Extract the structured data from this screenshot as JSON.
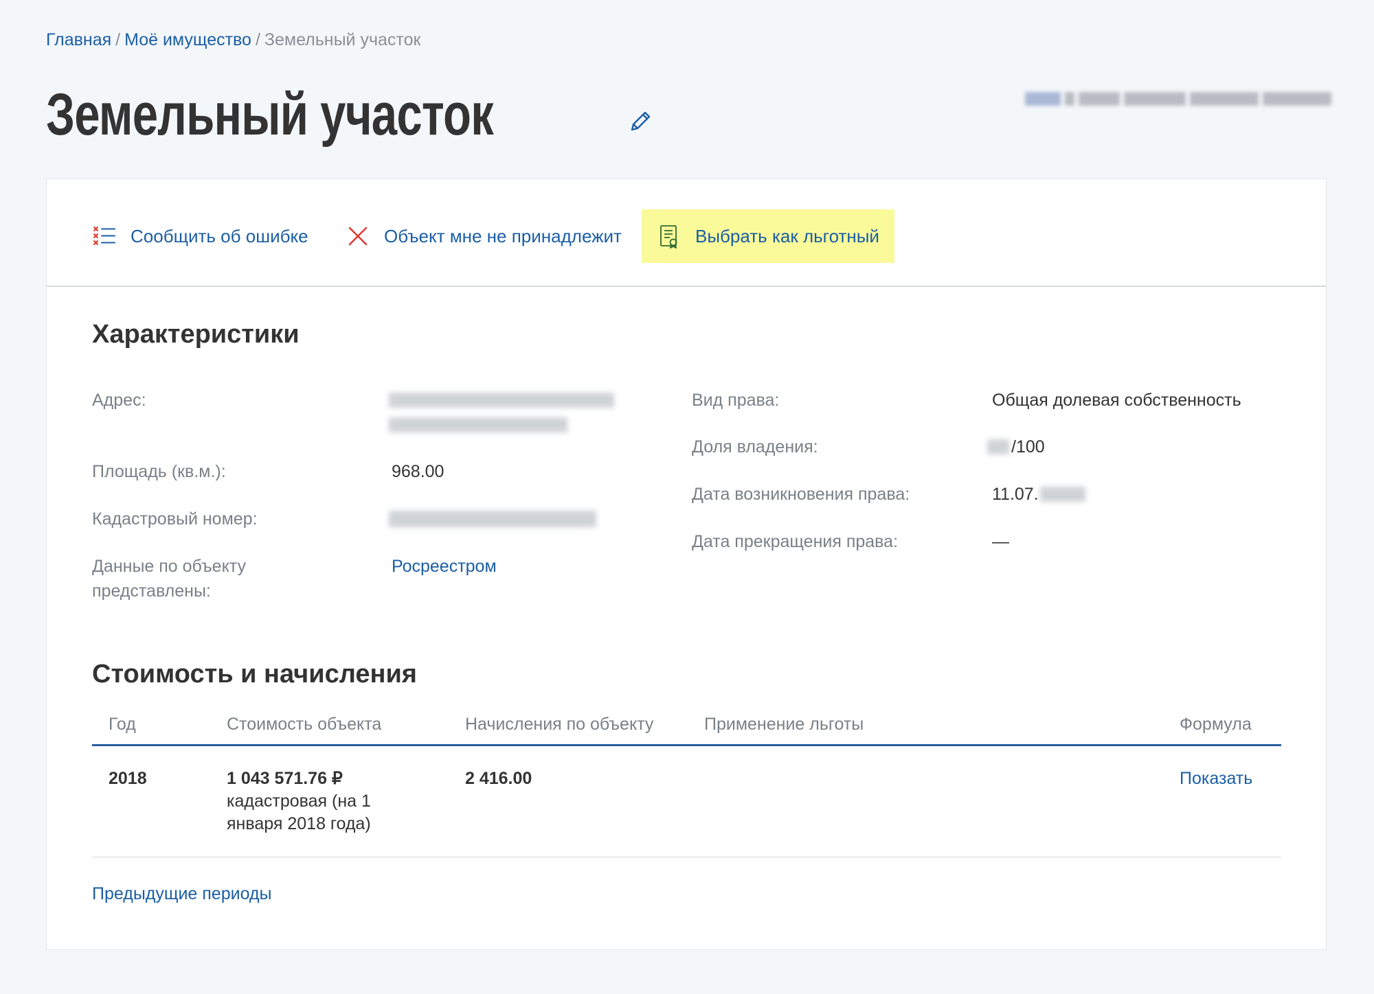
{
  "breadcrumb": {
    "home": "Главная",
    "property": "Моё имущество",
    "current": "Земельный участок",
    "separator": "/"
  },
  "page": {
    "title": "Земельный участок"
  },
  "actions": {
    "report_error": "Сообщить об ошибке",
    "not_mine": "Объект мне не принадлежит",
    "select_benefit": "Выбрать как льготный"
  },
  "characteristics": {
    "title": "Характеристики",
    "address_label": "Адрес:",
    "area_label": "Площадь (кв.м.):",
    "area_value": "968.00",
    "cadastral_label": "Кадастровый номер:",
    "source_label_line1": "Данные по объекту",
    "source_label_line2": "представлены:",
    "source_value": "Росреестром",
    "right_type_label": "Вид права:",
    "right_type_value": "Общая долевая собственность",
    "share_label": "Доля владения:",
    "share_value": "/100",
    "right_start_label": "Дата возникновения права:",
    "right_start_value": "11.07.",
    "right_end_label": "Дата прекращения права:",
    "right_end_value": "—"
  },
  "cost": {
    "title": "Стоимость и начисления",
    "columns": {
      "year": "Год",
      "value": "Стоимость объекта",
      "charges": "Начисления по объекту",
      "benefit": "Применение льготы",
      "formula": "Формула"
    },
    "rows": [
      {
        "year": "2018",
        "value": "1 043 571.76 ₽",
        "value_note_line1": "кадастровая (на 1",
        "value_note_line2": "января 2018 года)",
        "charges": "2 416.00",
        "formula_link": "Показать"
      }
    ],
    "previous_periods": "Предыдущие периоды"
  },
  "colors": {
    "link": "#1b5ea5",
    "highlight": "#fafa9a",
    "error_red": "#e0342b",
    "header_line": "#2a5fa0"
  }
}
